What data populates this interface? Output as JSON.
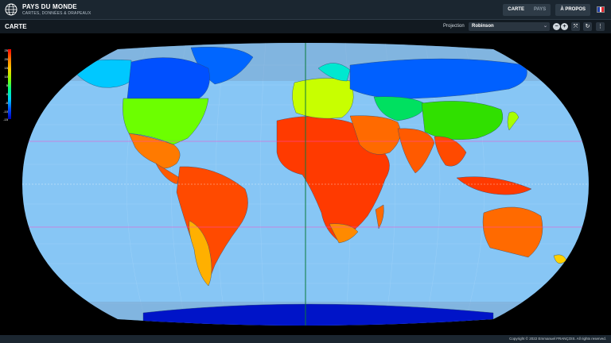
{
  "app": {
    "title": "PAYS DU MONDE",
    "subtitle": "CARTES, DONNÉES & DRAPEAUX"
  },
  "nav": {
    "map_label": "CARTE",
    "countries_label": "PAYS",
    "about_label": "À PROPOS",
    "language_flag": "france-flag"
  },
  "toolbar": {
    "section_title": "CARTE",
    "projection_label": "Projection",
    "projection_value": "Robinson"
  },
  "legend": {
    "ticks": [
      "25",
      "20",
      "15",
      "10",
      "5",
      "0",
      "-5",
      "-10",
      "-15"
    ]
  },
  "colors": {
    "ocean": "#87c6f5",
    "space": "#000000",
    "topbar": "#1b2630"
  },
  "footer": {
    "copyright": "Copyright © 2022 Emmanuel FRANÇOIS. All rights reserved."
  }
}
